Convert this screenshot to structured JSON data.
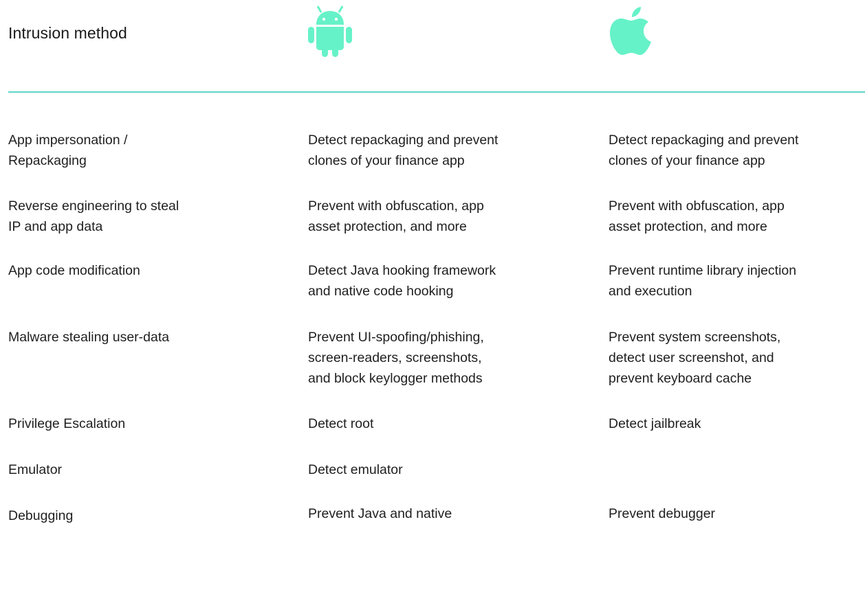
{
  "header": {
    "title": "Intrusion method",
    "android_icon": "android-icon",
    "apple_icon": "apple-icon",
    "accent_color": "#66F2C8",
    "divider_color": "#5ED6C3"
  },
  "rows": [
    {
      "method": "App impersonation /\nRepackaging",
      "android": "Detect repackaging and prevent\nclones of your finance app",
      "ios": "Detect repackaging and prevent\nclones of your finance app"
    },
    {
      "method": "Reverse engineering to steal\nIP and app data",
      "android": "Prevent with obfuscation, app\nasset protection, and more",
      "ios": "Prevent with obfuscation, app\nasset protection, and more"
    },
    {
      "method": "App code modification",
      "android": "Detect Java hooking framework\nand native code hooking",
      "ios": "Prevent runtime library injection\nand execution"
    },
    {
      "method": "Malware stealing user-data",
      "android": "Prevent UI-spoofing/phishing,\nscreen-readers, screenshots,\nand block keylogger methods",
      "ios": "Prevent system screenshots,\ndetect user screenshot, and\nprevent keyboard cache"
    },
    {
      "method": "Privilege Escalation",
      "android": "Detect root",
      "ios": "Detect jailbreak"
    },
    {
      "method": "Emulator",
      "android": "Detect emulator",
      "ios": ""
    },
    {
      "method": "Debugging",
      "android": "Prevent Java and native",
      "ios": "Prevent debugger"
    }
  ]
}
